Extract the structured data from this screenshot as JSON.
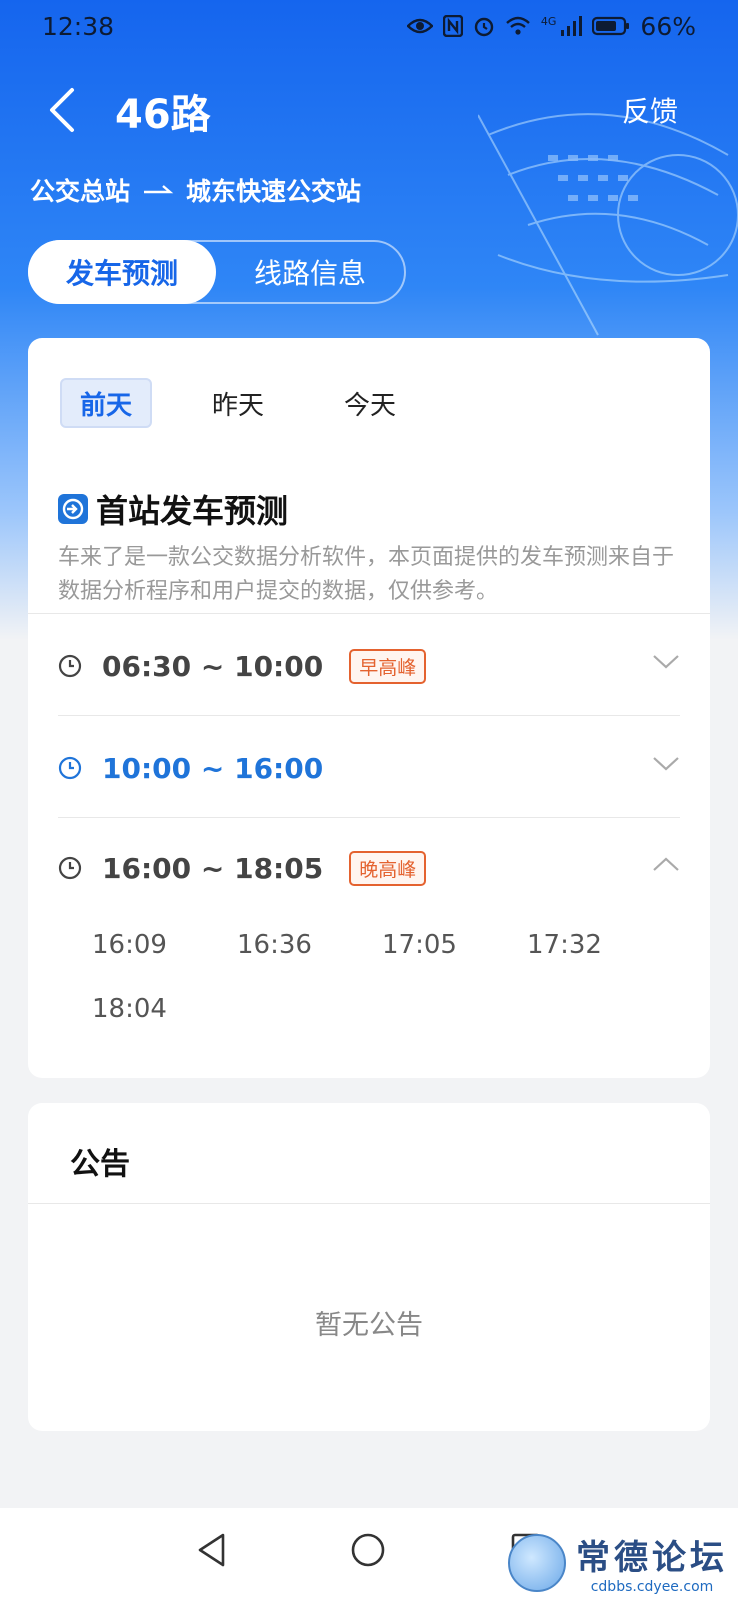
{
  "status_bar": {
    "time": "12:38",
    "battery": "66%",
    "network": "4G"
  },
  "header": {
    "route_name": "46路",
    "feedback_label": "反馈",
    "origin": "公交总站",
    "destination": "城东快速公交站"
  },
  "segment_tabs": [
    {
      "label": "发车预测",
      "active": true
    },
    {
      "label": "线路信息",
      "active": false
    }
  ],
  "day_tabs": [
    {
      "label": "前天",
      "active": true
    },
    {
      "label": "昨天",
      "active": false
    },
    {
      "label": "今天",
      "active": false
    }
  ],
  "forecast": {
    "title": "首站发车预测",
    "description": "车来了是一款公交数据分析软件，本页面提供的发车预测来自于数据分析程序和用户提交的数据，仅供参考。",
    "periods": [
      {
        "time": "06:30 ~ 10:00",
        "tag": "早高峰",
        "expanded": false,
        "highlighted": false
      },
      {
        "time": "10:00 ~ 16:00",
        "tag": "",
        "expanded": false,
        "highlighted": true
      },
      {
        "time": "16:00 ~ 18:05",
        "tag": "晚高峰",
        "expanded": true,
        "highlighted": false
      }
    ],
    "expanded_times": [
      "16:09",
      "16:36",
      "17:05",
      "17:32",
      "18:04"
    ]
  },
  "notice": {
    "title": "公告",
    "empty_text": "暂无公告"
  },
  "watermark": {
    "site_name": "常德论坛",
    "url": "cdbbs.cdyee.com"
  },
  "colors": {
    "primary_blue": "#1766e8",
    "peak_tag": "#e4622f",
    "hero_gradient_top": "#1565ee"
  }
}
